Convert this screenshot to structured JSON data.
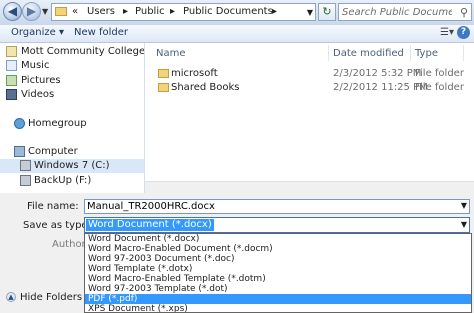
{
  "address_bar": {
    "crumbs": [
      "Users",
      "Public",
      "Public Documents"
    ],
    "overflow_glyph": "«",
    "search_placeholder": "Search Public Documents"
  },
  "toolbar": {
    "organize_label": "Organize ▾",
    "new_folder_label": "New folder",
    "help_label": "?"
  },
  "nav_pane": {
    "items": [
      {
        "label": "Mott Community College",
        "icon": "document-library-icon"
      },
      {
        "label": "Music",
        "icon": "music-icon"
      },
      {
        "label": "Pictures",
        "icon": "pictures-icon"
      },
      {
        "label": "Videos",
        "icon": "videos-icon"
      },
      {
        "label": "Homegroup",
        "icon": "homegroup-icon"
      },
      {
        "label": "Computer",
        "icon": "computer-icon"
      },
      {
        "label": "Windows 7 (C:)",
        "icon": "drive-icon",
        "selected": true
      },
      {
        "label": "BackUp (F:)",
        "icon": "drive-icon"
      }
    ]
  },
  "file_list": {
    "columns": [
      "Name",
      "Date modified",
      "Type"
    ],
    "rows": [
      {
        "name": "microsoft",
        "date": "2/3/2012 5:32 PM",
        "type": "File folder"
      },
      {
        "name": "Shared Books",
        "date": "2/2/2012 11:25 PM",
        "type": "File folder"
      }
    ]
  },
  "form": {
    "file_name_label": "File name:",
    "file_name_value": "Manual_TR2000HRC.docx",
    "save_type_label": "Save as type:",
    "save_type_value": "Word Document (*.docx)",
    "authors_label": "Authors:"
  },
  "save_type_options": [
    {
      "label": "Word Document (*.docx)",
      "selected": false
    },
    {
      "label": "Word Macro-Enabled Document (*.docm)",
      "selected": false
    },
    {
      "label": "Word 97-2003 Document (*.doc)",
      "selected": false
    },
    {
      "label": "Word Template (*.dotx)",
      "selected": false
    },
    {
      "label": "Word Macro-Enabled Template (*.dotm)",
      "selected": false
    },
    {
      "label": "Word 97-2003 Template (*.dot)",
      "selected": false
    },
    {
      "label": "PDF (*.pdf)",
      "selected": true
    },
    {
      "label": "XPS Document (*.xps)",
      "selected": false
    }
  ],
  "hide_folders_label": "Hide Folders",
  "colors": {
    "highlight": "#3399ff",
    "accent": "#1c3b66"
  }
}
